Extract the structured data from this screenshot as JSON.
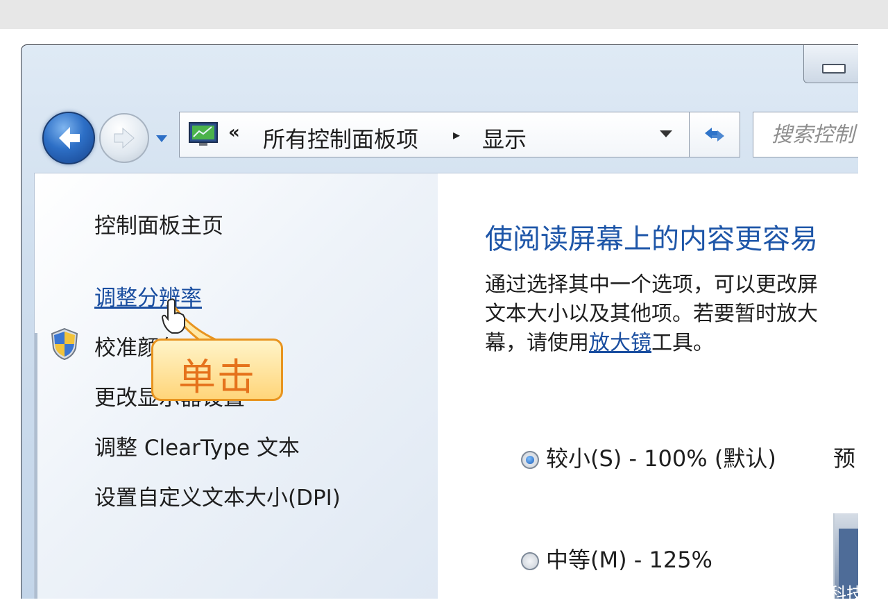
{
  "window": {
    "breadcrumb": {
      "chevron": "«",
      "items": [
        "所有控制面板项",
        "显示"
      ],
      "separator": "▸"
    },
    "search": {
      "placeholder": "搜索控制"
    }
  },
  "left_pane": {
    "home": "控制面板主页",
    "links": {
      "adjust_resolution": "调整分辨率",
      "calibrate_color": "校准颜色",
      "change_display": "更改显示器设置",
      "cleartype": "调整 ClearType 文本",
      "custom_dpi": "设置自定义文本大小(DPI)"
    }
  },
  "main": {
    "heading": "使阅读屏幕上的内容更容易",
    "description": {
      "line1": "通过选择其中一个选项，可以更改屏",
      "line2": "文本大小以及其他项。若要暂时放大",
      "line3_prefix": "幕，请使用",
      "line3_link": "放大镜",
      "line3_suffix": "工具。"
    },
    "options": [
      {
        "label": "较小(S) - 100% (默认)",
        "checked": true
      },
      {
        "label": "中等(M) - 125%",
        "checked": false
      }
    ],
    "preview_label": "预"
  },
  "annotation": {
    "text": "单击",
    "color": "#e5721c",
    "fill": "#ffd57a"
  },
  "watermark": "科技",
  "colors": {
    "link": "#1a4ea0",
    "heading": "#1e56a8",
    "chrome": "#cfdeee"
  },
  "icons": {
    "back": "back-arrow-icon",
    "forward": "forward-arrow-icon",
    "refresh": "refresh-icon",
    "shield": "uac-shield-icon",
    "display": "display-icon",
    "cursor": "hand-cursor-icon"
  }
}
